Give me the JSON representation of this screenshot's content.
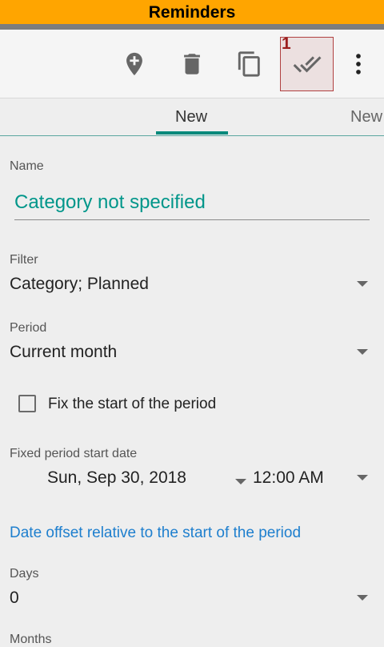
{
  "app": {
    "title": "Reminders"
  },
  "toolbar": {
    "add_location": "add-location",
    "delete": "delete",
    "copy": "copy",
    "apply_badge": "1",
    "more": "more"
  },
  "tabs": [
    {
      "label": "New",
      "active": true
    },
    {
      "label": "New",
      "active": false
    }
  ],
  "form": {
    "name_label": "Name",
    "name_value": "Category not specified",
    "filter_label": "Filter",
    "filter_value": "Category; Planned",
    "period_label": "Period",
    "period_value": "Current month",
    "fix_start_label": "Fix the start of the period",
    "fix_start_checked": false,
    "fixed_start_label": "Fixed period start date",
    "fixed_start_date": "Sun, Sep 30, 2018",
    "fixed_start_time": "12:00 AM",
    "offset_link": "Date offset relative to the start of the period",
    "days_label": "Days",
    "days_value": "0",
    "months_label": "Months"
  },
  "colors": {
    "title_bar": "#ffa500",
    "accent": "#00897b",
    "link": "#1e7fce",
    "badge": "#9b1f1f"
  }
}
